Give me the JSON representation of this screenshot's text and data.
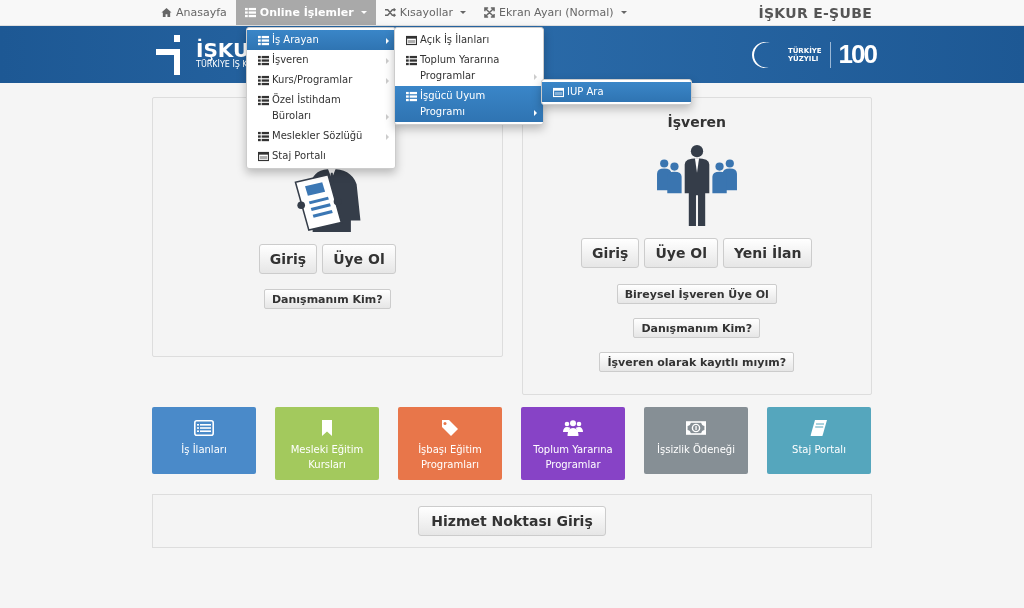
{
  "nav": {
    "items": [
      {
        "label": "Anasayfa",
        "kind": "home",
        "caret": false,
        "selected": false
      },
      {
        "label": "Online İşlemler",
        "kind": "list",
        "caret": true,
        "selected": true
      },
      {
        "label": "Kısayollar",
        "kind": "shuffle",
        "caret": true,
        "selected": false
      },
      {
        "label": "Ekran Ayarı (Normal)",
        "kind": "expand",
        "caret": true,
        "selected": false
      }
    ],
    "brand": "İŞKUR E-ŞUBE"
  },
  "header": {
    "logo_text": "İŞKU",
    "logo_subtitle": "TÜRKİYE İŞ K",
    "centenary_top": "TÜRKİYE",
    "centenary_bottom": "YÜZYILI",
    "centenary_number": "100"
  },
  "menus": [
    {
      "items": [
        {
          "label": "İş Arayan",
          "kind": "list",
          "selected": true,
          "submenu": true
        },
        {
          "label": "İşveren",
          "kind": "list",
          "selected": false,
          "submenu": true
        },
        {
          "label": "Kurs/Programlar",
          "kind": "list",
          "selected": false,
          "submenu": true
        },
        {
          "label": "Özel İstihdam Büroları",
          "kind": "list",
          "selected": false,
          "submenu": true
        },
        {
          "label": "Meslekler Sözlüğü",
          "kind": "list",
          "selected": false,
          "submenu": true
        },
        {
          "label": "Staj Portalı",
          "kind": "window",
          "selected": false,
          "submenu": false
        }
      ]
    },
    {
      "items": [
        {
          "label": "Açık İş İlanları",
          "kind": "window",
          "selected": false,
          "submenu": false
        },
        {
          "label": "Toplum Yararına Programlar",
          "kind": "list",
          "selected": false,
          "submenu": true
        },
        {
          "label": "İşgücü Uyum Programı",
          "kind": "list",
          "selected": true,
          "submenu": true
        }
      ]
    },
    {
      "items": [
        {
          "label": "IUP Ara",
          "kind": "window",
          "selected": true,
          "submenu": false
        }
      ]
    }
  ],
  "panels": [
    {
      "buttons": [
        "Giriş",
        "Üye Ol"
      ],
      "links": [
        "Danışmanım Kim?"
      ]
    },
    {
      "title": "İşveren",
      "buttons": [
        "Giriş",
        "Üye Ol",
        "Yeni İlan"
      ],
      "links": [
        "Bireysel İşveren Üye Ol",
        "Danışmanım Kim?",
        "İşveren olarak kayıtlı mıyım?"
      ]
    }
  ],
  "tiles": [
    {
      "label": "İş İlanları",
      "kind": "list-alt",
      "color": "#4a8ac9"
    },
    {
      "label": "Mesleki Eğitim Kursları",
      "kind": "bookmark",
      "color": "#a3c95d"
    },
    {
      "label": "İşbaşı Eğitim Programları",
      "kind": "tag",
      "color": "#e8764a"
    },
    {
      "label": "Toplum Yararına Programlar",
      "kind": "users",
      "color": "#8743c6"
    },
    {
      "label": "İşsizlik Ödeneği",
      "kind": "money",
      "color": "#868f95"
    },
    {
      "label": "Staj Portalı",
      "kind": "book",
      "color": "#55a6bd"
    }
  ],
  "service_button": "Hizmet Noktası Giriş"
}
